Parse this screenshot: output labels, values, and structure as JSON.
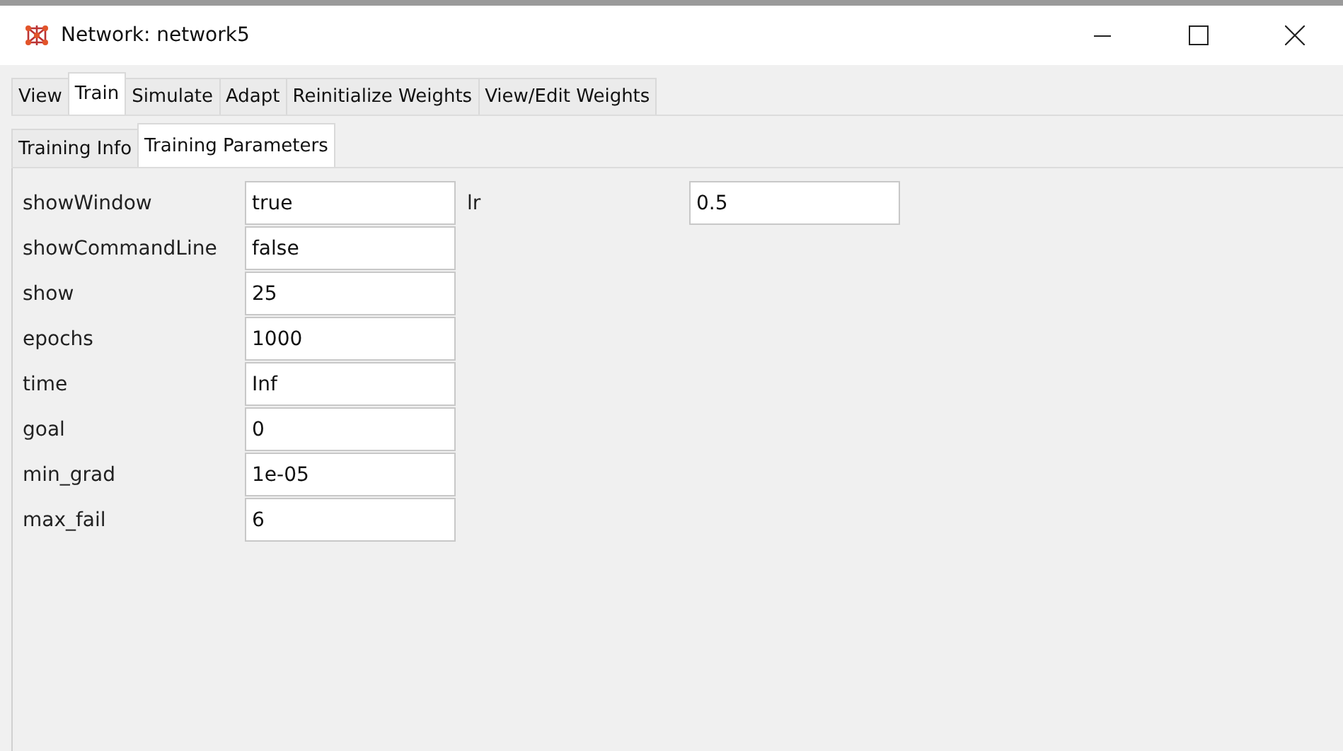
{
  "window": {
    "title": "Network: network5"
  },
  "tabs": [
    {
      "label": "View",
      "selected": false
    },
    {
      "label": "Train",
      "selected": true
    },
    {
      "label": "Simulate",
      "selected": false
    },
    {
      "label": "Adapt",
      "selected": false
    },
    {
      "label": "Reinitialize Weights",
      "selected": false
    },
    {
      "label": "View/Edit Weights",
      "selected": false
    }
  ],
  "subtabs": [
    {
      "label": "Training Info",
      "selected": false
    },
    {
      "label": "Training Parameters",
      "selected": true
    }
  ],
  "parameters_left": [
    {
      "name": "showWindow",
      "value": "true"
    },
    {
      "name": "showCommandLine",
      "value": "false"
    },
    {
      "name": "show",
      "value": "25"
    },
    {
      "name": "epochs",
      "value": "1000"
    },
    {
      "name": "time",
      "value": "Inf"
    },
    {
      "name": "goal",
      "value": "0"
    },
    {
      "name": "min_grad",
      "value": "1e-05"
    },
    {
      "name": "max_fail",
      "value": "6"
    }
  ],
  "parameters_right": [
    {
      "name": "lr",
      "value": "0.5"
    }
  ]
}
